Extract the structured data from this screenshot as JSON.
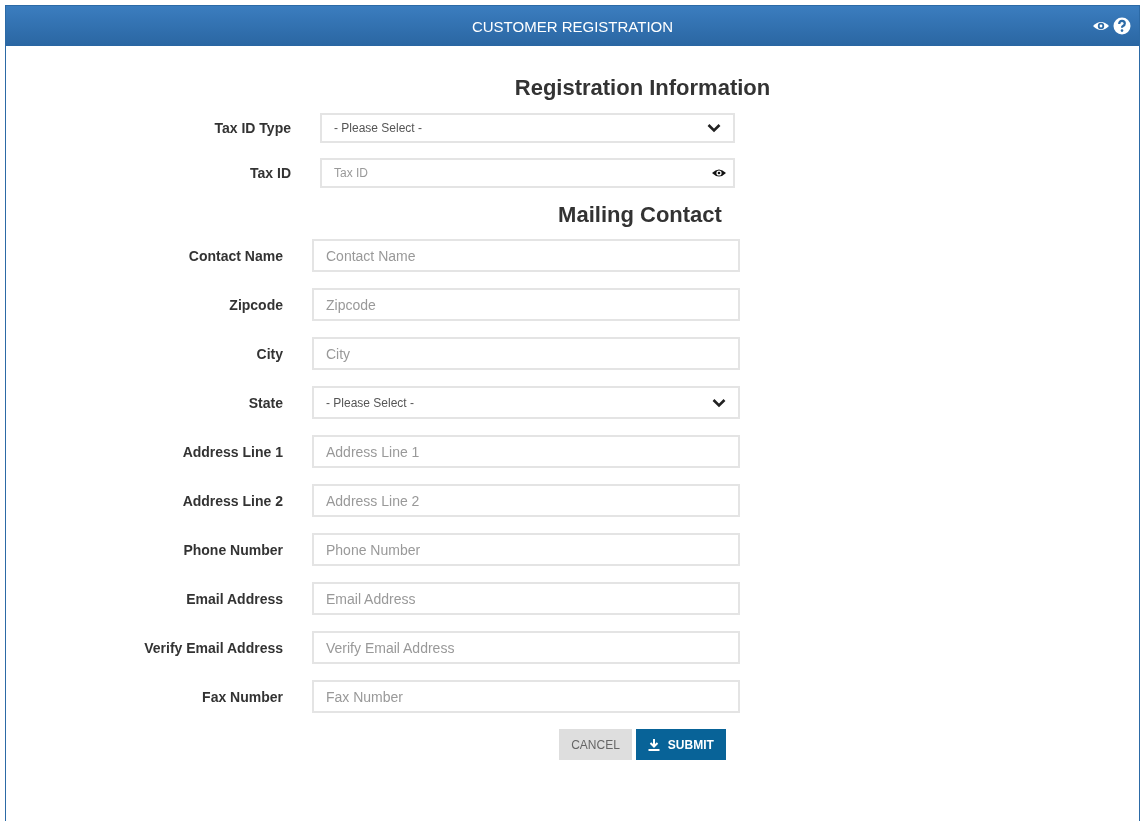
{
  "header": {
    "title": "CUSTOMER REGISTRATION"
  },
  "sections": [
    {
      "heading": "Registration Information",
      "fields": [
        {
          "label": "Tax ID Type",
          "kind": "select",
          "value": "- Please Select -"
        },
        {
          "label": "Tax ID",
          "kind": "secret",
          "placeholder": "Tax ID"
        }
      ]
    },
    {
      "heading": "Mailing Contact",
      "fields": [
        {
          "label": "Contact Name",
          "kind": "text",
          "placeholder": "Contact Name"
        },
        {
          "label": "Zipcode",
          "kind": "text",
          "placeholder": "Zipcode"
        },
        {
          "label": "City",
          "kind": "text",
          "placeholder": "City"
        },
        {
          "label": "State",
          "kind": "select",
          "value": "- Please Select -"
        },
        {
          "label": "Address Line 1",
          "kind": "text",
          "placeholder": "Address Line 1"
        },
        {
          "label": "Address Line 2",
          "kind": "text",
          "placeholder": "Address Line 2"
        },
        {
          "label": "Phone Number",
          "kind": "text",
          "placeholder": "Phone Number"
        },
        {
          "label": "Email Address",
          "kind": "text",
          "placeholder": "Email Address"
        },
        {
          "label": "Verify Email Address",
          "kind": "text",
          "placeholder": "Verify Email Address"
        },
        {
          "label": "Fax Number",
          "kind": "text",
          "placeholder": "Fax Number"
        }
      ]
    }
  ],
  "buttons": [
    {
      "label": "CANCEL",
      "kind": "secondary"
    },
    {
      "label": "SUBMIT",
      "kind": "primary"
    }
  ]
}
